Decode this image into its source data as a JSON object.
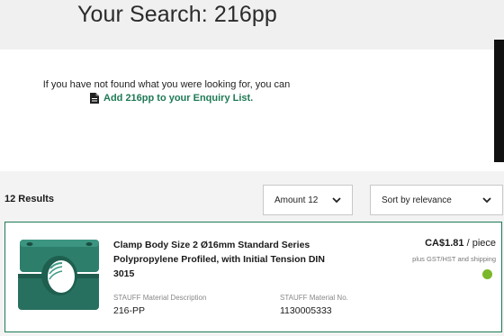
{
  "header": {
    "title": "Your Search: 216pp"
  },
  "notice": {
    "text": "If you have not found what you were looking for, you can",
    "link_label": "Add 216pp to your Enquiry List.",
    "link_icon": "document-icon"
  },
  "results": {
    "count_label": "12 Results",
    "amount_dropdown": {
      "selected": "Amount 12"
    },
    "sort_dropdown": {
      "selected": "Sort by relevance"
    }
  },
  "products": [
    {
      "title": "Clamp Body Size 2 Ø16mm Standard Series Polypropylene Profiled, with Initial Tension DIN 3015",
      "price": "CA$1.81",
      "price_unit": " / piece",
      "tax_note": "plus GST/HST and shipping",
      "stock_status_color": "#7ab82a",
      "description_label": "STAUFF Material Description",
      "description_value": "216-PP",
      "material_no_label": "STAUFF Material No.",
      "material_no_value": "1130005333"
    }
  ],
  "colors": {
    "accent": "#1e7a55",
    "product": "#2e7e6c"
  }
}
